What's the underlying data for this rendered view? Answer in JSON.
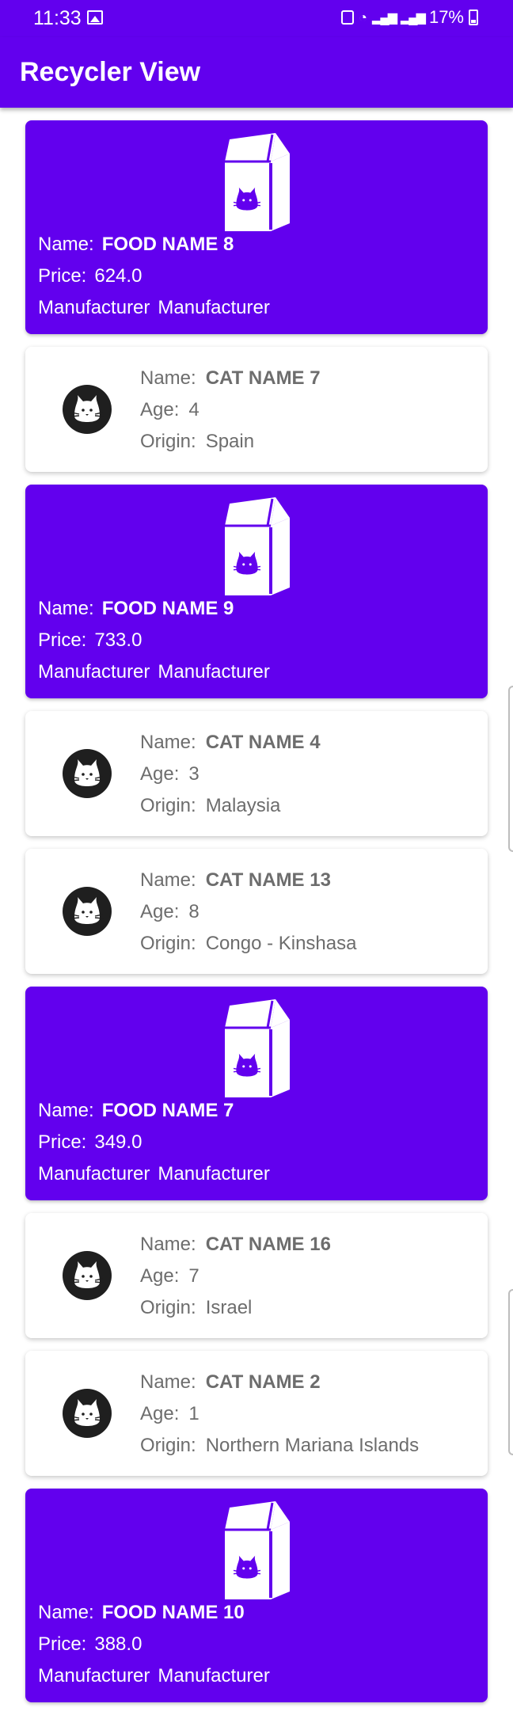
{
  "status_bar": {
    "time": "11:33",
    "battery": "17%",
    "icons": [
      "image-icon",
      "alarm-icon",
      "wifi-icon",
      "signal-icon",
      "signal-icon",
      "battery-icon"
    ]
  },
  "app_bar": {
    "title": "Recycler View"
  },
  "list": {
    "items": [
      {
        "kind": "food",
        "name_label": "Name:",
        "name": "FOOD NAME 8",
        "price_label": "Price:",
        "price": "624.0",
        "manufacturer_label": "Manufacturer",
        "manufacturer": "Manufacturer"
      },
      {
        "kind": "cat",
        "name_label": "Name:",
        "name": "CAT NAME 7",
        "age_label": "Age:",
        "age": "4",
        "origin_label": "Origin:",
        "origin": "Spain"
      },
      {
        "kind": "food",
        "name_label": "Name:",
        "name": "FOOD NAME 9",
        "price_label": "Price:",
        "price": "733.0",
        "manufacturer_label": "Manufacturer",
        "manufacturer": "Manufacturer"
      },
      {
        "kind": "cat",
        "name_label": "Name:",
        "name": "CAT NAME 4",
        "age_label": "Age:",
        "age": "3",
        "origin_label": "Origin:",
        "origin": "Malaysia"
      },
      {
        "kind": "cat",
        "name_label": "Name:",
        "name": "CAT NAME 13",
        "age_label": "Age:",
        "age": "8",
        "origin_label": "Origin:",
        "origin": "Congo - Kinshasa"
      },
      {
        "kind": "food",
        "name_label": "Name:",
        "name": "FOOD NAME 7",
        "price_label": "Price:",
        "price": "349.0",
        "manufacturer_label": "Manufacturer",
        "manufacturer": "Manufacturer"
      },
      {
        "kind": "cat",
        "name_label": "Name:",
        "name": "CAT NAME 16",
        "age_label": "Age:",
        "age": "7",
        "origin_label": "Origin:",
        "origin": "Israel"
      },
      {
        "kind": "cat",
        "name_label": "Name:",
        "name": "CAT NAME 2",
        "age_label": "Age:",
        "age": "1",
        "origin_label": "Origin:",
        "origin": "Northern Mariana Islands"
      },
      {
        "kind": "food",
        "name_label": "Name:",
        "name": "FOOD NAME 10",
        "price_label": "Price:",
        "price": "388.0",
        "manufacturer_label": "Manufacturer",
        "manufacturer": "Manufacturer"
      }
    ]
  },
  "colors": {
    "primary": "#6200ee",
    "cat_text": "#6d6d6d",
    "avatar": "#1f1f1f"
  }
}
